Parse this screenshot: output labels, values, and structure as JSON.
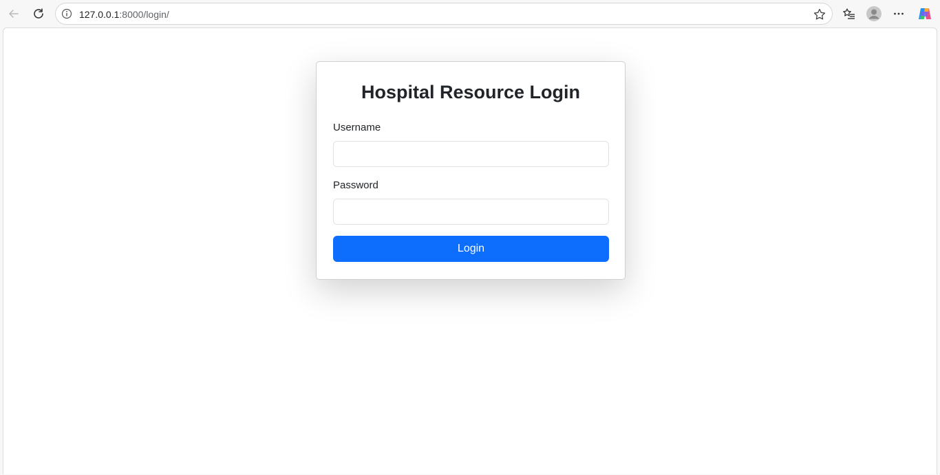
{
  "browser": {
    "url_host": "127.0.0.1",
    "url_path": ":8000/login/",
    "icons": {
      "back": "arrow-left-icon",
      "reload": "reload-icon",
      "info": "info-icon",
      "favorite": "star-icon",
      "favorites": "favorites-list-icon",
      "profile": "profile-avatar-icon",
      "menu": "more-dots-icon",
      "copilot": "copilot-icon"
    }
  },
  "login": {
    "title": "Hospital Resource Login",
    "username_label": "Username",
    "username_value": "",
    "password_label": "Password",
    "password_value": "",
    "submit_label": "Login"
  },
  "colors": {
    "primary": "#0d6efd",
    "text": "#212529"
  }
}
